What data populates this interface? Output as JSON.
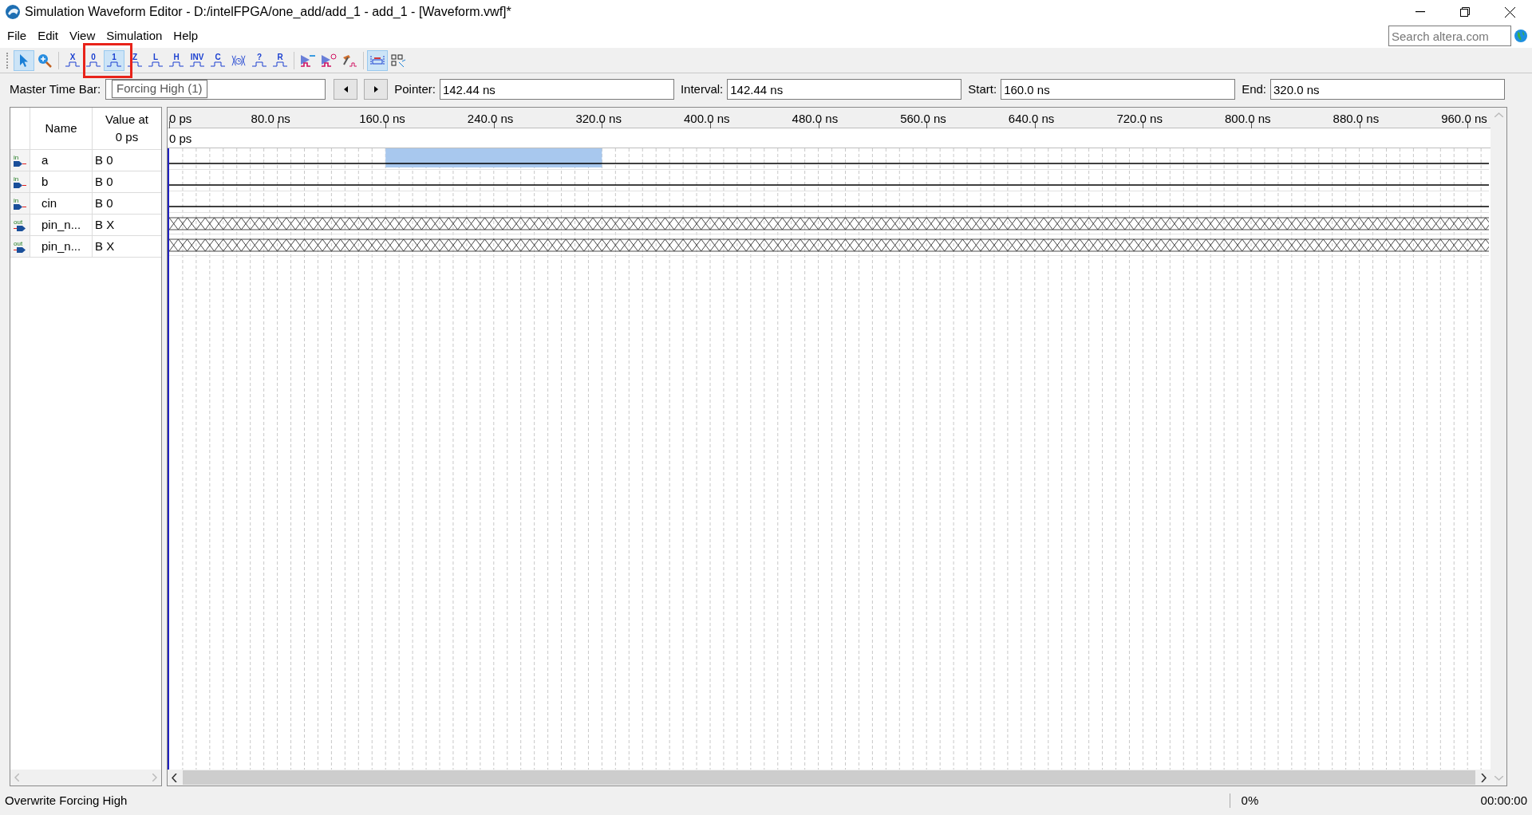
{
  "window": {
    "title": "Simulation Waveform Editor - D:/intelFPGA/one_add/add_1 - add_1 - [Waveform.vwf]*"
  },
  "menu": [
    "File",
    "Edit",
    "View",
    "Simulation",
    "Help"
  ],
  "search": {
    "placeholder": "Search altera.com"
  },
  "toolbar": [
    [
      {
        "kind": "pointer",
        "selected": true
      },
      {
        "kind": "zoom",
        "selected": false
      }
    ],
    [
      {
        "kind": "glyph",
        "glyph": "X",
        "selected": false
      },
      {
        "kind": "glyph",
        "glyph": "0",
        "selected": false
      },
      {
        "kind": "glyph",
        "glyph": "1",
        "selected": true
      },
      {
        "kind": "glyph",
        "glyph": "Z",
        "selected": false
      },
      {
        "kind": "glyph",
        "glyph": "L",
        "selected": false
      },
      {
        "kind": "glyph",
        "glyph": "H",
        "selected": false
      },
      {
        "kind": "glyph",
        "glyph": "INV",
        "selected": false
      },
      {
        "kind": "glyph",
        "glyph": "C",
        "selected": false
      },
      {
        "kind": "clock",
        "selected": false
      },
      {
        "kind": "glyph",
        "glyph": "?",
        "selected": false
      },
      {
        "kind": "glyph",
        "glyph": "R",
        "selected": false
      }
    ],
    [
      {
        "kind": "simulate",
        "selected": false
      },
      {
        "kind": "simulate-timing",
        "selected": false
      },
      {
        "kind": "hammer",
        "selected": false
      }
    ],
    [
      {
        "kind": "snap",
        "selected": true
      },
      {
        "kind": "grid",
        "selected": false
      }
    ]
  ],
  "tooltip": "Forcing High (1)",
  "time_bar": {
    "master_label": "Master Time Bar:",
    "pointer_label": "Pointer:",
    "pointer": "142.44 ns",
    "interval_label": "Interval:",
    "interval": "142.44 ns",
    "start_label": "Start:",
    "start": "160.0 ns",
    "end_label": "End:",
    "end": "320.0 ns"
  },
  "table": {
    "columns": [
      "Name",
      "Value at\n0 ps"
    ],
    "rows": [
      {
        "pin": "in",
        "kind": "input",
        "name": "a",
        "value": "B 0",
        "undefined": false
      },
      {
        "pin": "in",
        "kind": "input",
        "name": "b",
        "value": "B 0",
        "undefined": false
      },
      {
        "pin": "in",
        "kind": "input",
        "name": "cin",
        "value": "B 0",
        "undefined": false
      },
      {
        "pin": "out",
        "kind": "output",
        "name": "pin_n...",
        "value": "B X",
        "undefined": true
      },
      {
        "pin": "out",
        "kind": "output",
        "name": "pin_n...",
        "value": "B X",
        "undefined": true
      }
    ]
  },
  "ruler": [
    "0 ps",
    "80.0 ns",
    "160.0 ns",
    "240.0 ns",
    "320.0 ns",
    "400.0 ns",
    "480.0 ns",
    "560.0 ns",
    "640.0 ns",
    "720.0 ns",
    "800.0 ns",
    "880.0 ns",
    "960.0 ns"
  ],
  "cursor_label": "0 ps",
  "status_bar": {
    "message": "Overwrite Forcing High",
    "progress": "0%",
    "time": "00:00:00"
  }
}
